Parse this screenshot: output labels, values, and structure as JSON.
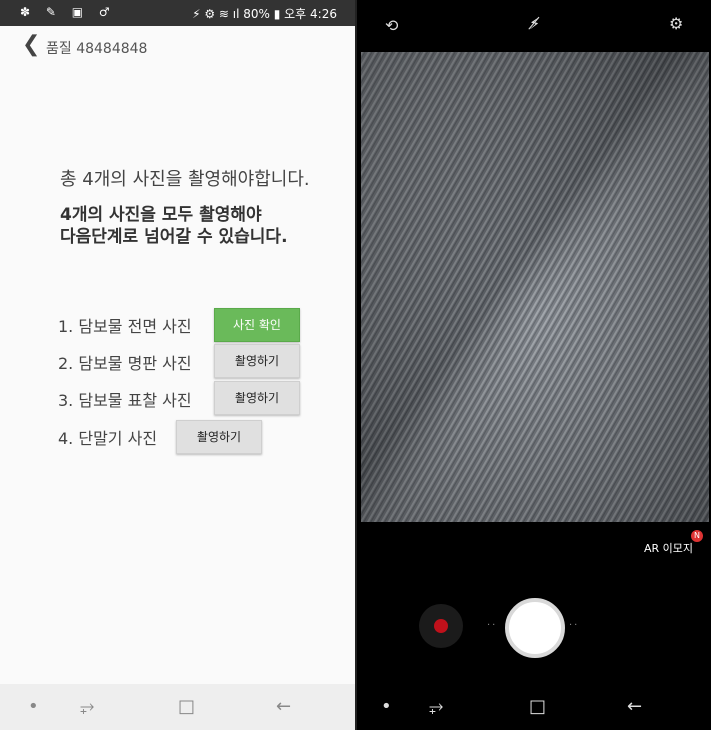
{
  "left": {
    "status": {
      "left_icons": "✽ ✎ ▣ ♂",
      "right_text": "⚡ ⚙ ≋ ıl 80% ▮ 오후 4:26"
    },
    "appbar": {
      "back_icon": "❮",
      "title": "품질 48484848"
    },
    "message1": "총 4개의 사진을 촬영해야합니다.",
    "message2_line1": "4개의 사진을 모두 촬영해야",
    "message2_line2": "다음단계로 넘어갈 수 있습니다.",
    "items": [
      {
        "label": "1. 담보물 전면 사진",
        "button": "사진 확인"
      },
      {
        "label": "2. 담보물 명판 사진",
        "button": "촬영하기"
      },
      {
        "label": "3. 담보물 표찰 사진",
        "button": "촬영하기"
      },
      {
        "label": "4. 단말기 사진",
        "button": "촬영하기"
      }
    ],
    "nav": {
      "dot": "•",
      "recent": "⥅",
      "home": "□",
      "back": "←"
    }
  },
  "right": {
    "top_icons": {
      "switch": "⟲",
      "flash": "⚡̸",
      "settings": "⚙"
    },
    "ar_label": "AR 이모지",
    "ar_badge": "N",
    "nav": {
      "dot": "•",
      "recent": "⥅",
      "home": "□",
      "back": "←"
    }
  },
  "colors": {
    "confirm_button": "#6aba5a",
    "status_bar": "#333333",
    "record_dot": "#c0111b"
  }
}
